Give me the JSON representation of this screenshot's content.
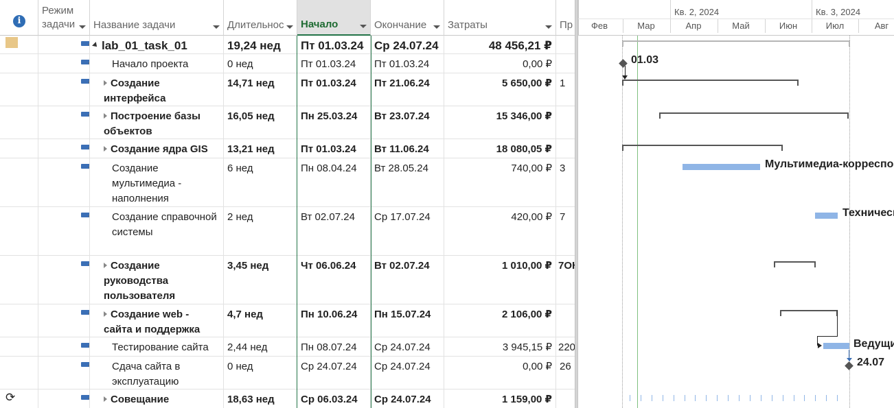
{
  "headers": {
    "info_symbol": "i",
    "mode": "Режим задачи",
    "name": "Название задачи",
    "duration": "Длительнос",
    "start": "Начало",
    "finish": "Окончание",
    "cost": "Затраты",
    "pred": "Пр"
  },
  "timescale": {
    "quarters": [
      "Кв. 2, 2024",
      "Кв. 3, 2024"
    ],
    "months": [
      "Фев",
      "Мар",
      "Апр",
      "Май",
      "Июн",
      "Июл",
      "Авг"
    ]
  },
  "rows": [
    {
      "name": "lab_01_task_01",
      "duration": "19,24 нед",
      "start": "Пт 01.03.24",
      "finish": "Ср 24.07.24",
      "cost": "48 456,21 ₽",
      "pred": ""
    },
    {
      "name": "Начало проекта",
      "duration": "0 нед",
      "start": "Пт 01.03.24",
      "finish": "Пт 01.03.24",
      "cost": "0,00 ₽",
      "pred": ""
    },
    {
      "name": "Создание интерфейса",
      "duration": "14,71 нед",
      "start": "Пт 01.03.24",
      "finish": "Пт 21.06.24",
      "cost": "5 650,00 ₽",
      "pred": "1"
    },
    {
      "name": "Построение базы объектов",
      "duration": "16,05 нед",
      "start": "Пн 25.03.24",
      "finish": "Вт 23.07.24",
      "cost": "15 346,00 ₽",
      "pred": ""
    },
    {
      "name": "Создание ядра GIS",
      "duration": "13,21 нед",
      "start": "Пт 01.03.24",
      "finish": "Вт 11.06.24",
      "cost": "18 080,05 ₽",
      "pred": ""
    },
    {
      "name": "Создание мультимедиа - наполнения",
      "duration": "6 нед",
      "start": "Пн 08.04.24",
      "finish": "Вт 28.05.24",
      "cost": "740,00 ₽",
      "pred": "3"
    },
    {
      "name": "Создание справочной системы",
      "duration": "2 нед",
      "start": "Вт 02.07.24",
      "finish": "Ср 17.07.24",
      "cost": "420,00 ₽",
      "pred": "7"
    },
    {
      "name": "Создание руководства пользователя",
      "duration": "3,45 нед",
      "start": "Чт 06.06.24",
      "finish": "Вт 02.07.24",
      "cost": "1 010,00 ₽",
      "pred": "7ОН"
    },
    {
      "name": "Создание web - сайта и поддержка",
      "duration": "4,7 нед",
      "start": "Пн 10.06.24",
      "finish": "Пн 15.07.24",
      "cost": "2 106,00 ₽",
      "pred": ""
    },
    {
      "name": "Тестирование сайта",
      "duration": "2,44 нед",
      "start": "Пн 08.07.24",
      "finish": "Ср 24.07.24",
      "cost": "3 945,15 ₽",
      "pred": "220"
    },
    {
      "name": "Сдача сайта в эксплуатацию",
      "duration": "0 нед",
      "start": "Ср 24.07.24",
      "finish": "Ср 24.07.24",
      "cost": "0,00 ₽",
      "pred": "26"
    },
    {
      "name": "Совещание",
      "duration": "18,63 нед",
      "start": "Ср 06.03.24",
      "finish": "Ср 24.07.24",
      "cost": "1 159,00 ₽",
      "pred": ""
    }
  ],
  "gantt": {
    "milestone_start_label": "01.03",
    "milestone_end_label": "24.07",
    "resource_multimedia": "Мультимедиа-корреспондент",
    "resource_help": "Технический писатель",
    "resource_test": "Ведущий"
  }
}
